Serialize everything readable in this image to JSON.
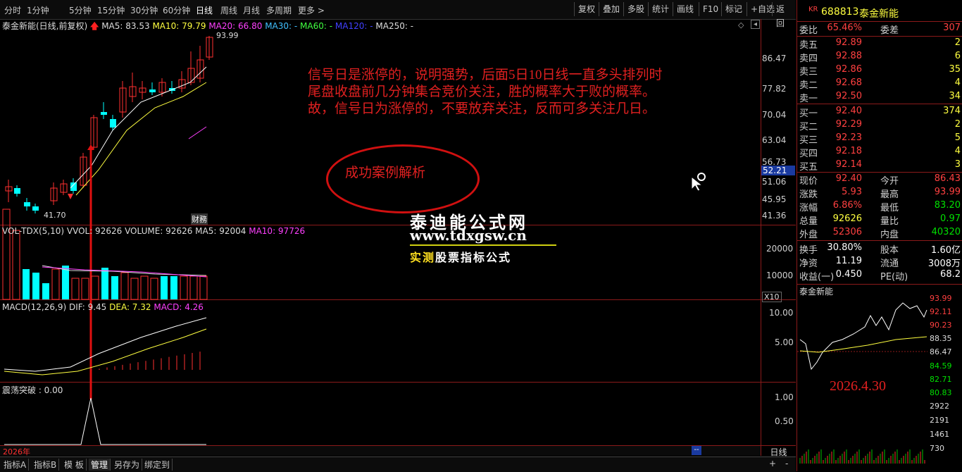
{
  "toolbar": {
    "periods": [
      "分时",
      "1分钟",
      "5分钟",
      "15分钟",
      "30分钟",
      "60分钟",
      "日线",
      "周线",
      "月线",
      "多周期",
      "更多 >"
    ],
    "active_period": "日线",
    "right_buttons": [
      "复权",
      "叠加",
      "多股",
      "统计",
      "画线",
      "F10",
      "标记",
      "+自选",
      "返回"
    ]
  },
  "main_legend": {
    "title": "泰金新能(日线,前复权)",
    "ma5": "MA5: 83.53",
    "ma10": "MA10: 79.79",
    "ma20": "MA20: 66.80",
    "ma30": "MA30: -",
    "ma60": "MA60: -",
    "ma120": "MA120: -",
    "ma250": "MA250: -",
    "high_label": "93.99",
    "low_label": "41.70",
    "marker_lbl": "财務",
    "cursor_price": "52.21"
  },
  "price_axis": [
    "86.47",
    "77.82",
    "70.04",
    "63.04",
    "56.73",
    "51.06",
    "45.95",
    "41.36"
  ],
  "volume_legend": {
    "title": "VOL-TDX(5,10)",
    "vvol": "VVOL: 92626",
    "volume": "VOLUME: 92626",
    "ma5": "MA5: 92004",
    "ma10": "MA10: 97726"
  },
  "volume_axis": [
    "20000",
    "10000"
  ],
  "volume_unit": "X10",
  "macd_legend": {
    "title": "MACD(12,26,9)",
    "dif": "DIF: 9.45",
    "dea": "DEA: 7.32",
    "macd": "MACD: 4.26"
  },
  "macd_axis": [
    "10.00",
    "5.00"
  ],
  "breakout_legend": {
    "title": "震荡突破 : 0.00"
  },
  "breakout_axis": [
    "1.00",
    "0.50"
  ],
  "year_label": "2026年",
  "bottom_tabs": [
    "指标A",
    "指标B",
    "模 板",
    "管理",
    "另存为",
    "绑定到"
  ],
  "bottom_active": "管理",
  "period_btn": "日线",
  "annotation": {
    "lines": [
      "信号日是涨停的，说明强势，后面5日10日线一直多头排列时",
      "尾盘收盘前几分钟集合竞价关注，胜的概率大于败的概率。",
      "故，信号日为涨停的，不要放弃关注，反而可多关注几日。"
    ],
    "ellipse_text": "成功案例解析"
  },
  "watermark": {
    "line1": "泰迪能公式网",
    "line2": "www.tdxgsw.cn",
    "line3a": "实测",
    "line3b": "股票指标公式"
  },
  "quote": {
    "kr": "KR",
    "code": "688813",
    "name": "泰金新能",
    "weibi_label": "委比",
    "weibi": "65.46%",
    "weicha_label": "委差",
    "weicha": "307",
    "asks": [
      {
        "label": "卖五",
        "price": "92.89",
        "vol": "2"
      },
      {
        "label": "卖四",
        "price": "92.88",
        "vol": "6"
      },
      {
        "label": "卖三",
        "price": "92.86",
        "vol": "35"
      },
      {
        "label": "卖二",
        "price": "92.68",
        "vol": "4"
      },
      {
        "label": "卖一",
        "price": "92.50",
        "vol": "34"
      }
    ],
    "bids": [
      {
        "label": "买一",
        "price": "92.40",
        "vol": "374"
      },
      {
        "label": "买二",
        "price": "92.29",
        "vol": "2"
      },
      {
        "label": "买三",
        "price": "92.23",
        "vol": "5"
      },
      {
        "label": "买四",
        "price": "92.18",
        "vol": "4"
      },
      {
        "label": "买五",
        "price": "92.14",
        "vol": "3"
      }
    ],
    "stats": [
      {
        "l1": "现价",
        "v1": "92.40",
        "c1": "red",
        "l2": "今开",
        "v2": "86.43",
        "c2": "red"
      },
      {
        "l1": "涨跌",
        "v1": "5.93",
        "c1": "red",
        "l2": "最高",
        "v2": "93.99",
        "c2": "red"
      },
      {
        "l1": "涨幅",
        "v1": "6.86%",
        "c1": "red",
        "l2": "最低",
        "v2": "83.20",
        "c2": "green"
      },
      {
        "l1": "总量",
        "v1": "92626",
        "c1": "yellow",
        "l2": "量比",
        "v2": "0.97",
        "c2": "green"
      },
      {
        "l1": "外盘",
        "v1": "52306",
        "c1": "red",
        "l2": "内盘",
        "v2": "40320",
        "c2": "green"
      }
    ],
    "stats2": [
      {
        "l1": "换手",
        "v1": "30.80%",
        "l2": "股本",
        "v2": "1.60亿"
      },
      {
        "l1": "净资",
        "v1": "11.19",
        "l2": "流通",
        "v2": "3008万"
      },
      {
        "l1": "收益(一)",
        "v1": "0.450",
        "l2": "PE(动)",
        "v2": "68.2"
      }
    ],
    "mini_title": "泰金新能",
    "mini_axis": [
      "93.99",
      "92.11",
      "90.23",
      "88.35",
      "86.47",
      "84.59",
      "82.71",
      "80.83"
    ],
    "mini_vol_axis": [
      "2922",
      "2191",
      "1461",
      "730"
    ],
    "date_stamp": "2026.4.30"
  },
  "colors": {
    "up": "#ff3030",
    "down": "#00ffff",
    "frame": "#8b1a1a",
    "ma5": "#ffffff",
    "ma10": "#ffff00",
    "ma20": "#ff40ff"
  }
}
